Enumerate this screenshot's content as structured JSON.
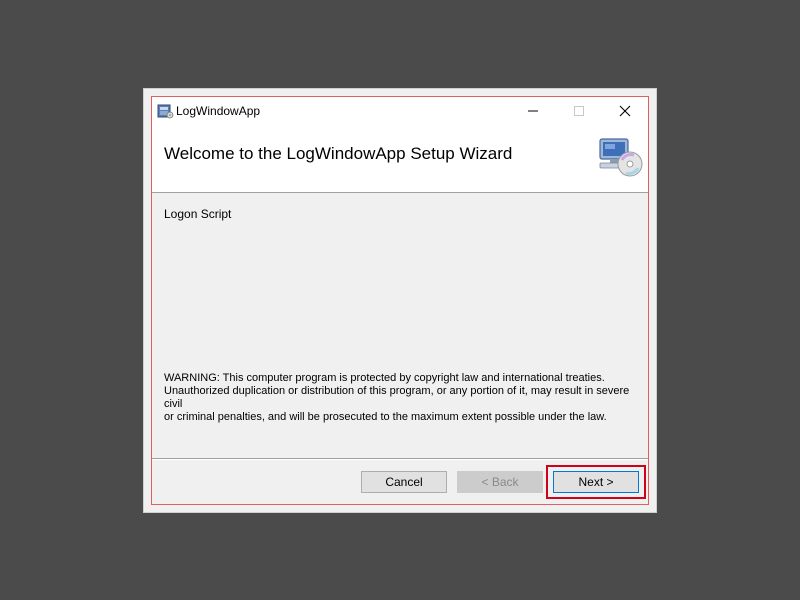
{
  "window": {
    "title": "LogWindowApp",
    "controls": {
      "minimize_icon": "minimize-icon",
      "maximize_icon": "maximize-icon",
      "close_icon": "close-icon"
    }
  },
  "banner": {
    "heading": "Welcome to the LogWindowApp Setup Wizard",
    "icon": "computer-disc-icon"
  },
  "content": {
    "subtitle": "Logon Script",
    "warning_line1": "WARNING: This computer program is protected by copyright law and international treaties.",
    "warning_line2": "Unauthorized duplication or distribution of this program, or any portion of it, may result in severe civil",
    "warning_line3": "or criminal penalties, and will be prosecuted to the maximum extent possible under the law."
  },
  "buttons": {
    "cancel": "Cancel",
    "back": "< Back",
    "next": "Next >",
    "back_enabled": false
  },
  "colors": {
    "desktop": "#4b4b4b",
    "highlight": "#d0021b",
    "default_button_border": "#0078d7"
  }
}
